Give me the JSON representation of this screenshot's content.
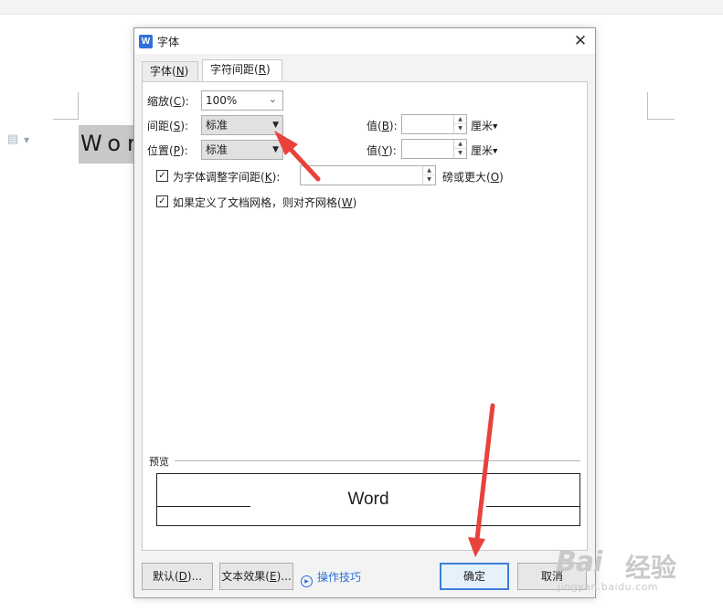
{
  "background_doc": {
    "word_text": "Wor",
    "doc_icon": "document-icon"
  },
  "dialog": {
    "title": "字体",
    "app_icon_text": "W",
    "close_glyph": "✕",
    "tabs": [
      {
        "label": "字体(N)",
        "mnemonic": "N",
        "pre": "字体(",
        "post": ")",
        "active": false
      },
      {
        "label": "字符间距(R)",
        "mnemonic": "R",
        "pre": "字符间距(",
        "post": ")",
        "active": true
      }
    ],
    "scale": {
      "label_pre": "缩放(",
      "mn": "C",
      "label_post": "):",
      "value": "100%"
    },
    "spacing": {
      "label_pre": "间距(",
      "mn": "S",
      "label_post": "):",
      "value": "标准"
    },
    "position": {
      "label_pre": "位置(",
      "mn": "P",
      "label_post": "):",
      "value": "标准"
    },
    "spacing_by": {
      "label_pre": "值(",
      "mn": "B",
      "label_post": "):",
      "value": "",
      "unit": "厘米"
    },
    "position_by": {
      "label_pre": "值(",
      "mn": "Y",
      "label_post": "):",
      "value": "",
      "unit": "厘米"
    },
    "kerning": {
      "checked": true,
      "label_pre": "为字体调整字间距(",
      "mn": "K",
      "label_post": "):",
      "value": "",
      "suffix_pre": "磅或更大(",
      "suffix_mn": "O",
      "suffix_post": ")"
    },
    "grid": {
      "checked": true,
      "label_pre": "如果定义了文档网格，则对齐网格(",
      "mn": "W",
      "label_post": ")"
    },
    "preview": {
      "label": "预览",
      "sample": "Word"
    },
    "buttons": {
      "default_pre": "默认(",
      "default_mn": "D",
      "default_post": ")...",
      "effects_pre": "文本效果(",
      "effects_mn": "E",
      "effects_post": ")...",
      "tips": "操作技巧",
      "ok": "确定",
      "cancel": "取消"
    },
    "colors": {
      "accent": "#3d7dd6",
      "link": "#2b6fd6",
      "annotation_arrow": "#e8423b"
    }
  },
  "watermark": {
    "logo": "Bai",
    "cn": "经验",
    "url": "jingyan.baidu.com"
  }
}
